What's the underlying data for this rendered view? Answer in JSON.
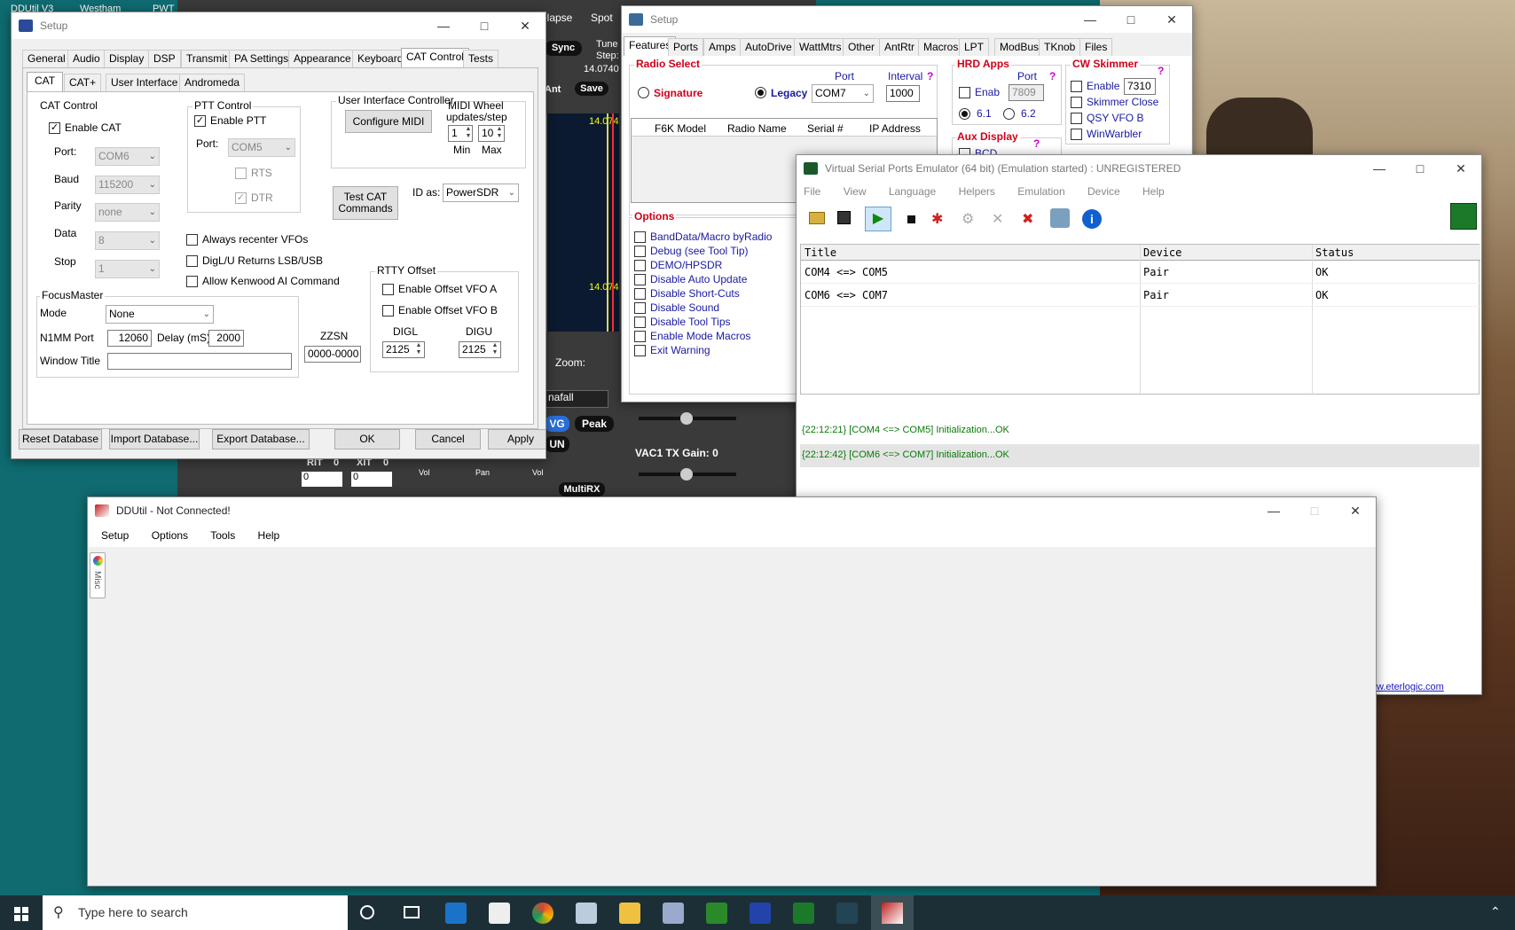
{
  "bg": {
    "top_left": "DDUtil V3",
    "top_mid1": "Westham",
    "top_mid2": "PWT",
    "top_right1": "llapse",
    "top_right2": "Spot"
  },
  "radio": {
    "sync": "Sync",
    "tune": "Tune",
    "step": "Step:",
    "freq1": "14.0740",
    "ant": "Ant",
    "save": "Save",
    "scale1": "14.074",
    "scale2": "14.074",
    "zoom": "Zoom:",
    "waterfall": "nafall",
    "avg": "VG",
    "peak": "Peak",
    "un": "UN",
    "vac": "VAC1 TX Gain: 0",
    "rit": "RIT",
    "rit_val": "0",
    "xit": "XIT",
    "xit_val": "0",
    "rit_num": "0",
    "xit_num": "0",
    "vol1": "Vol",
    "pan": "Pan",
    "vol2": "Vol",
    "multirx": "MultiRX"
  },
  "setup1": {
    "title": "Setup",
    "tabs": [
      "General",
      "Audio",
      "Display",
      "DSP",
      "Transmit",
      "PA Settings",
      "Appearance",
      "Keyboard",
      "CAT Control",
      "Tests"
    ],
    "subtabs": [
      "CAT",
      "CAT+",
      "User Interface",
      "Andromeda"
    ],
    "cat_group": "CAT Control",
    "enable_cat": "Enable CAT",
    "port_lbl": "Port:",
    "port_val": "COM6",
    "baud_lbl": "Baud",
    "baud_val": "115200",
    "parity_lbl": "Parity",
    "parity_val": "none",
    "data_lbl": "Data",
    "data_val": "8",
    "stop_lbl": "Stop",
    "stop_val": "1",
    "ptt_group": "PTT Control",
    "enable_ptt": "Enable PTT",
    "ptt_port_lbl": "Port:",
    "ptt_port_val": "COM5",
    "rts": "RTS",
    "dtr": "DTR",
    "uic_group": "User Interface Controller",
    "configure_midi": "Configure MIDI",
    "midi_lbl1": "MIDI  Wheel",
    "midi_lbl2": "updates/step",
    "midi_min_val": "1",
    "midi_max_val": "10",
    "min": "Min",
    "max": "Max",
    "test_cat1": "Test CAT",
    "test_cat2": "Commands",
    "id_as_lbl": "ID as:",
    "id_as_val": "PowerSDR",
    "always_recenter": "Always recenter VFOs",
    "digl": "DigL/U Returns LSB/USB",
    "allow_kenwood": "Allow Kenwood AI Command",
    "rtty_group": "RTTY Offset",
    "offset_a": "Enable Offset VFO A",
    "offset_b": "Enable Offset VFO B",
    "digl_lbl": "DIGL",
    "digu_lbl": "DIGU",
    "digl_val": "2125",
    "digu_val": "2125",
    "focus_group": "FocusMaster",
    "mode_lbl": "Mode",
    "mode_val": "None",
    "n1mm_lbl": "N1MM Port",
    "n1mm_val": "12060",
    "delay_lbl": "Delay (mS)",
    "delay_val": "2000",
    "window_title_lbl": "Window Title",
    "window_title_val": "",
    "zzsn_lbl": "ZZSN",
    "zzsn_val": "0000-0000",
    "reset_db": "Reset Database",
    "import_db": "Import Database...",
    "export_db": "Export Database...",
    "ok": "OK",
    "cancel": "Cancel",
    "apply": "Apply"
  },
  "setup2": {
    "title": "Setup",
    "tabs": [
      "Features",
      "Ports",
      "Amps",
      "AutoDrive",
      "WattMtrs",
      "Other",
      "AntRtr",
      "Macros",
      "LPT",
      "ModBus",
      "TKnob",
      "Files"
    ],
    "radio_select": "Radio Select",
    "port_lbl": "Port",
    "interval_lbl": "Interval",
    "q": "?",
    "signature": "Signature",
    "legacy": "Legacy",
    "port_val": "COM7",
    "interval_val": "1000",
    "cols": [
      "F6K Model",
      "Radio Name",
      "Serial #",
      "IP Address"
    ],
    "hrd": "HRD Apps",
    "hrd_port_lbl": "Port",
    "enab": "Enab",
    "hrd_port_val": "7809",
    "v61": "6.1",
    "v62": "6.2",
    "aux": "Aux Display",
    "bcd": "BCD",
    "cw": "CW Skimmer",
    "cw_enable": "Enable",
    "cw_port_val": "7310",
    "skimmer_close": "Skimmer Close",
    "qsy": "QSY VFO B",
    "winwarbler": "WinWarbler",
    "options": "Options",
    "opts": [
      "BandData/Macro byRadio",
      "Debug (see Tool Tip)",
      "DEMO/HPSDR",
      "Disable Auto Update",
      "Disable Short-Cuts",
      "Disable Sound",
      "Disable Tool Tips",
      "Enable Mode Macros",
      "Exit Warning"
    ]
  },
  "vspe": {
    "title": "Virtual Serial Ports Emulator (64 bit) (Emulation started) : UNREGISTERED",
    "menu": [
      "File",
      "View",
      "Language",
      "Helpers",
      "Emulation",
      "Device",
      "Help"
    ],
    "cols": [
      "Title",
      "Device",
      "Status"
    ],
    "rows": [
      {
        "title": "COM4 <=> COM5",
        "device": "Pair",
        "status": "OK"
      },
      {
        "title": "COM6 <=> COM7",
        "device": "Pair",
        "status": "OK"
      }
    ],
    "log": [
      "{22:12:21} [COM4 <=> COM5] Initialization...OK",
      "{22:12:42} [COM6 <=> COM7] Initialization...OK"
    ],
    "link": "w.eterlogic.com"
  },
  "ddutil": {
    "title": "DDUtil - Not Connected!",
    "menu": [
      "Setup",
      "Options",
      "Tools",
      "Help"
    ],
    "side_tab": "Misc"
  },
  "taskbar": {
    "search": "Type here to search"
  },
  "colors": {
    "desktop": "#0f6b70",
    "taskbar": "#1d2f36",
    "option_blue": "#1a1aa0",
    "header_red": "#d0001a",
    "help_magenta": "#d000d0",
    "log_green": "#0a7a0a"
  }
}
